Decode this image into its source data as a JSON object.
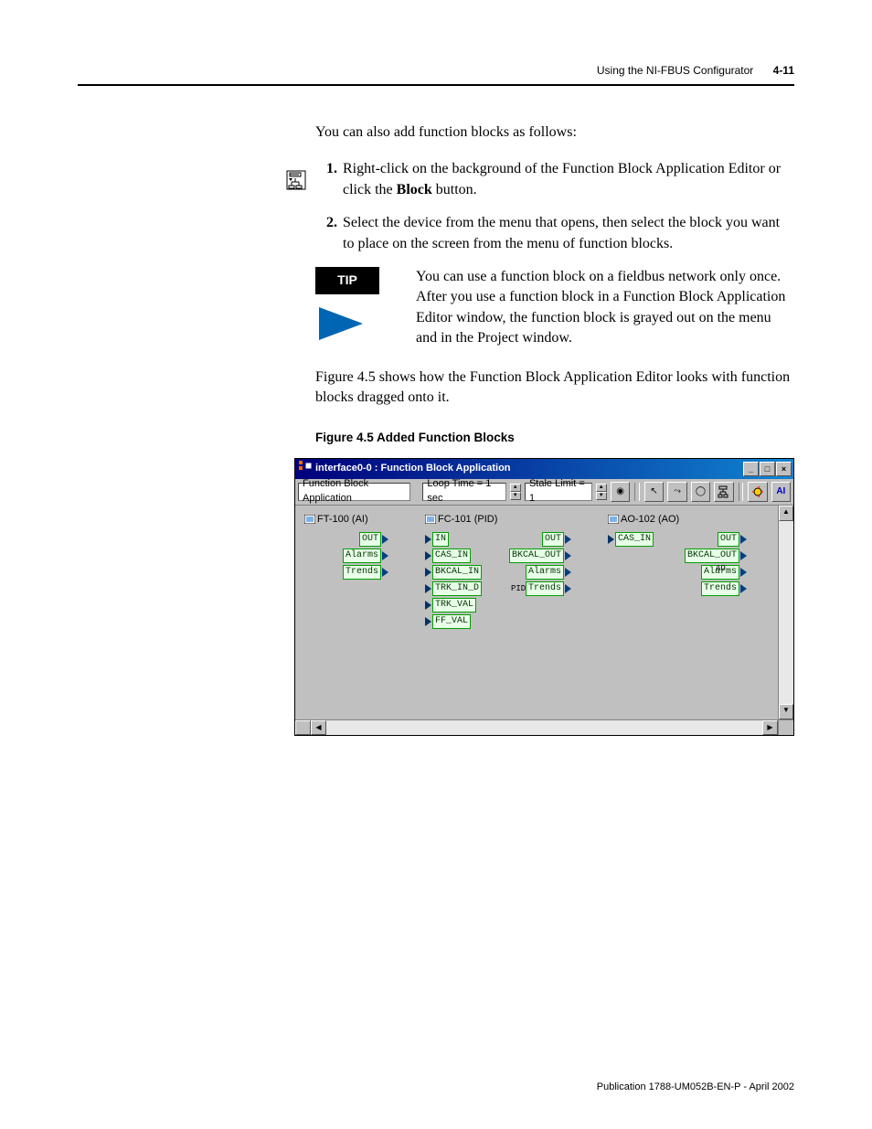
{
  "header": {
    "section": "Using the NI-FBUS Configurator",
    "page_num": "4-11"
  },
  "intro": "You can also add function blocks as follows:",
  "steps": [
    {
      "n": "1.",
      "pre": "Right-click on the background of the Function Block Application Editor or click the ",
      "bold": "Block",
      "post": " button."
    },
    {
      "n": "2.",
      "pre": "Select the device from the menu that opens, then select the block you want to place on the screen from the menu of function blocks.",
      "bold": "",
      "post": ""
    }
  ],
  "tip": {
    "label": "TIP",
    "text": "You can use a function block on a fieldbus network only once. After you use a function block in a Function Block Application Editor window, the function block is grayed out on the menu and in the Project window."
  },
  "after_tip": "Figure 4.5 shows how the Function Block Application Editor looks with function blocks dragged onto it.",
  "figure_caption": "Figure 4.5 Added Function Blocks",
  "window": {
    "title": "interface0-0 : Function Block Application",
    "toolbar": {
      "app_label": "Function Block Application",
      "loop_time": "Loop Time = 1 sec",
      "stale_limit": "Stale Limit = 1"
    },
    "blocks": {
      "b1": {
        "title": "FT-100 (AI)",
        "outs": [
          "OUT",
          "Alarms",
          "Trends"
        ]
      },
      "b2": {
        "title": "FC-101 (PID)",
        "ins": [
          "IN",
          "CAS_IN",
          "BKCAL_IN",
          "TRK_IN_D",
          "TRK_VAL",
          "FF_VAL"
        ],
        "outs": [
          "OUT",
          "BKCAL_OUT",
          "Alarms",
          "Trends"
        ],
        "sub": "PID"
      },
      "b3": {
        "title": "AO-102 (AO)",
        "ins": [
          "CAS_IN"
        ],
        "outs": [
          "OUT",
          "BKCAL_OUT",
          "Alarms",
          "Trends"
        ],
        "sub": "AO"
      }
    }
  },
  "footer": "Publication 1788-UM052B-EN-P - April 2002"
}
